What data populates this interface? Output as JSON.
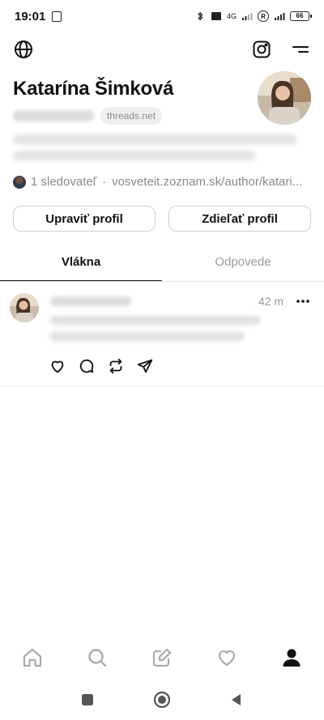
{
  "status_bar": {
    "time": "19:01",
    "network": "4G",
    "roaming": "R",
    "battery": "66"
  },
  "profile": {
    "name": "Katarína Šimková",
    "domain_badge": "threads.net",
    "followers_text": "1 sledovateľ",
    "separator": "·",
    "link_text": "vosveteit.zoznam.sk/author/katari..."
  },
  "buttons": {
    "edit_profile": "Upraviť profil",
    "share_profile": "Zdieľať profil"
  },
  "tabs": [
    {
      "label": "Vlákna",
      "active": true
    },
    {
      "label": "Odpovede",
      "active": false
    }
  ],
  "post": {
    "time": "42 m"
  },
  "icons": {
    "top_left": "globe-icon",
    "top_right_1": "instagram-icon",
    "top_right_2": "menu-icon",
    "post_actions": [
      "heart-icon",
      "comment-icon",
      "repost-icon",
      "send-icon"
    ],
    "bottom_nav": [
      "home-icon",
      "search-icon",
      "compose-icon",
      "activity-heart-icon",
      "profile-icon"
    ]
  },
  "colors": {
    "text": "#111111",
    "muted": "#999999",
    "border": "#cfcfcf"
  }
}
